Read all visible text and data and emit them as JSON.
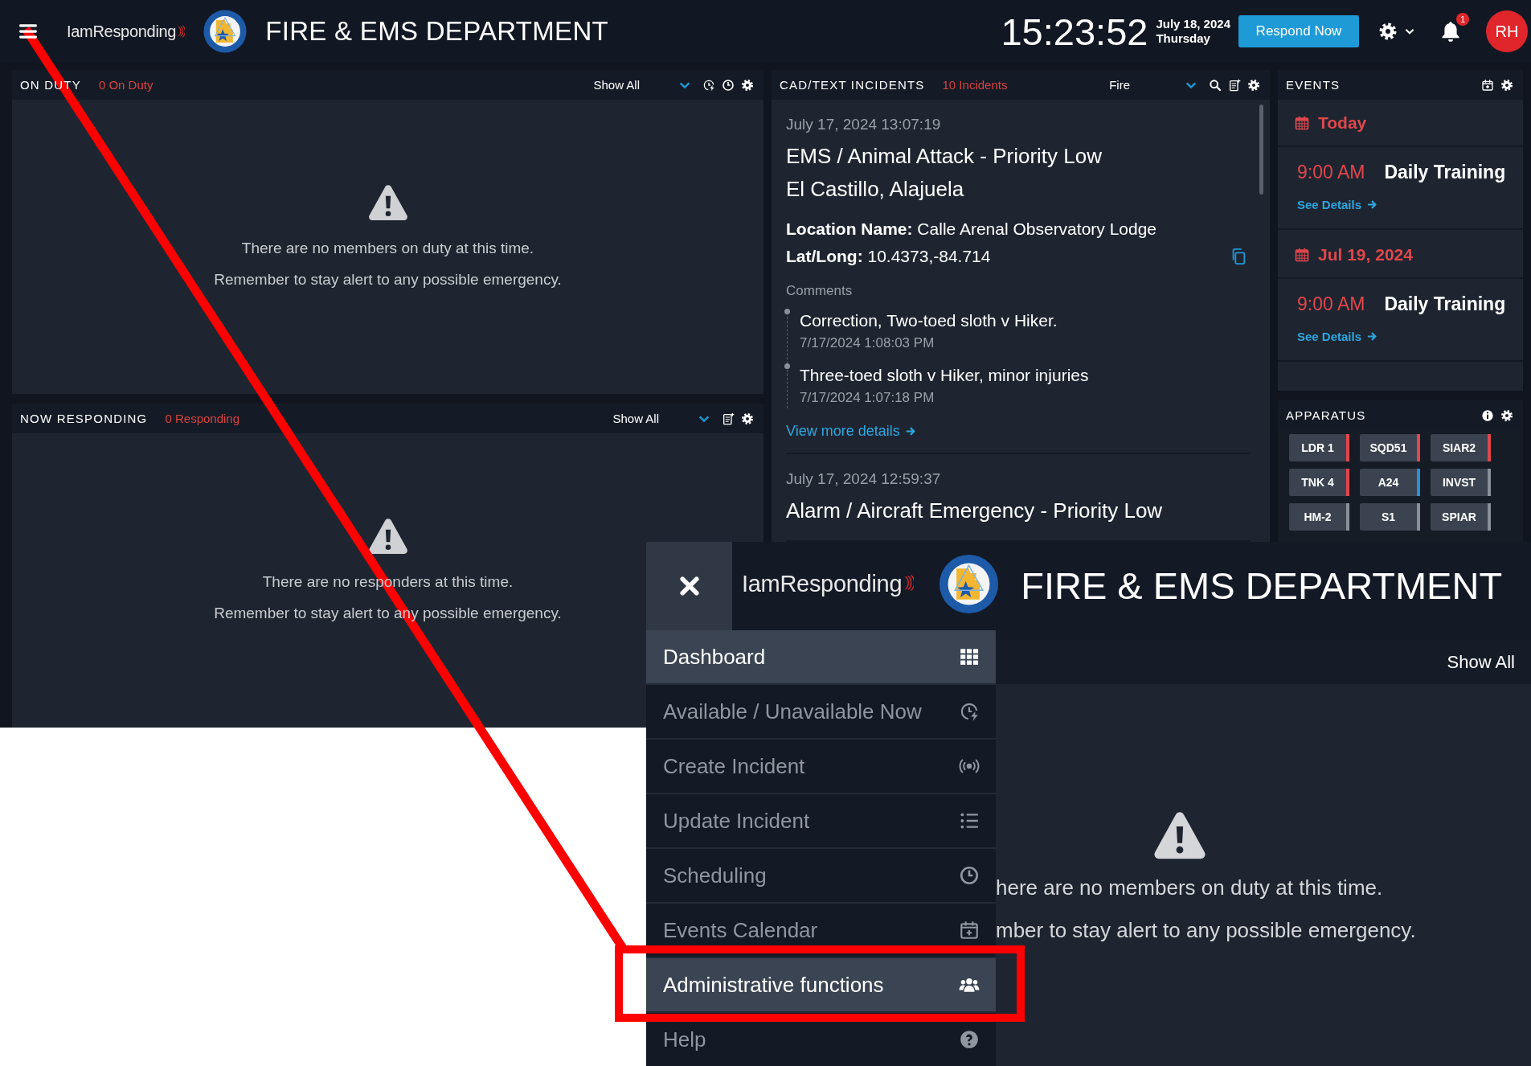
{
  "header": {
    "brand": "IamResponding",
    "title": "FIRE & EMS DEPARTMENT",
    "time": "15:23:52",
    "date": "July 18, 2024",
    "weekday": "Thursday",
    "respond_button": "Respond Now",
    "notification_count": "1",
    "avatar": "RH"
  },
  "on_duty": {
    "title": "ON DUTY",
    "count": "0 On Duty",
    "filter": "Show All",
    "empty_lines": [
      "There are no members on duty at this time.",
      "Remember to stay alert to any possible emergency."
    ]
  },
  "now_responding": {
    "title": "NOW RESPONDING",
    "count": "0 Responding",
    "filter": "Show All",
    "empty_lines": [
      "There are no responders at this time.",
      "Remember to stay alert to any possible emergency."
    ]
  },
  "incidents": {
    "title": "CAD/TEXT INCIDENTS",
    "count": "10 Incidents",
    "filter": "Fire",
    "items": [
      {
        "timestamp": "July 17, 2024 13:07:19",
        "title": "EMS / Animal Attack - Priority Low",
        "place": "El Castillo, Alajuela",
        "location_name": "**Location Name:** Calle Arenal Observatory Lodge",
        "lat_long": "**Lat/Long:** 10.4373,-84.714",
        "comments_label": "Comments",
        "comments": [
          {
            "text": "Correction, Two-toed sloth v Hiker.",
            "time": "7/17/2024 1:08:03 PM"
          },
          {
            "text": "Three-toed sloth v Hiker, minor injuries",
            "time": "7/17/2024 1:07:18 PM"
          }
        ],
        "more_link": "View more details"
      },
      {
        "timestamp": "July 17, 2024 12:59:37",
        "title": "Alarm / Aircraft Emergency - Priority Low"
      }
    ]
  },
  "events": {
    "title": "EVENTS",
    "groups": [
      {
        "date": "Today",
        "items": [
          {
            "time": "9:00 AM",
            "name": "Daily Training",
            "link": "See Details"
          }
        ]
      },
      {
        "date": "Jul 19, 2024",
        "items": [
          {
            "time": "9:00 AM",
            "name": "Daily Training",
            "link": "See Details"
          }
        ]
      }
    ]
  },
  "apparatus": {
    "title": "APPARATUS",
    "units": [
      {
        "label": "LDR 1",
        "color": "#e0474c"
      },
      {
        "label": "SQD51",
        "color": "#e0474c"
      },
      {
        "label": "SIAR2",
        "color": "#e0474c"
      },
      {
        "label": "TNK 4",
        "color": "#e0474c"
      },
      {
        "label": "A24",
        "color": "#2a8fd8"
      },
      {
        "label": "INVST",
        "color": "#8a9099"
      },
      {
        "label": "HM-2",
        "color": "#8a9099"
      },
      {
        "label": "S1",
        "color": "#8a9099"
      },
      {
        "label": "SPIAR",
        "color": "#8a9099"
      }
    ]
  },
  "inset": {
    "brand": "IamResponding",
    "title": "FIRE & EMS DEPARTMENT",
    "filter": "Show All",
    "empty_lines": [
      "here are no members on duty at this time.",
      "mber to stay alert to any possible emergency."
    ],
    "menu": [
      {
        "label": "Dashboard",
        "selected": true
      },
      {
        "label": "Available / Unavailable Now",
        "selected": false
      },
      {
        "label": "Create Incident",
        "selected": false
      },
      {
        "label": "Update Incident",
        "selected": false
      },
      {
        "label": "Scheduling",
        "selected": false
      },
      {
        "label": "Events Calendar",
        "selected": false
      },
      {
        "label": "Administrative functions",
        "selected": true
      },
      {
        "label": "Help",
        "selected": false
      }
    ]
  }
}
